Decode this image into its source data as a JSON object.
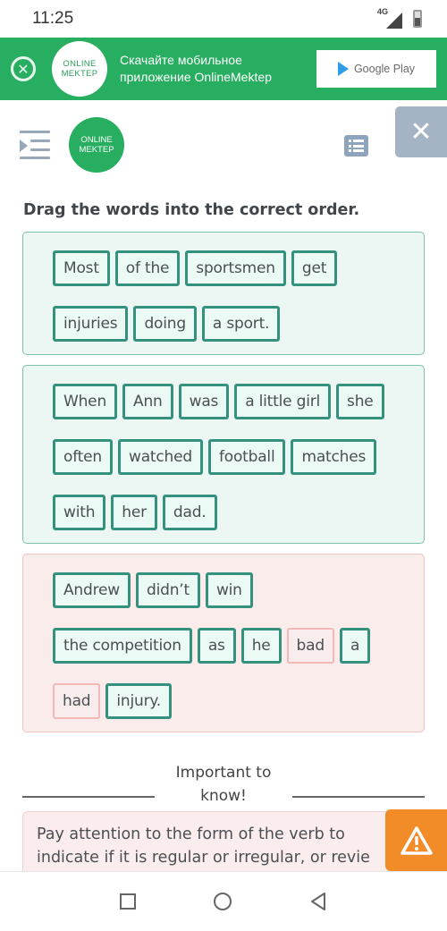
{
  "status_bar": {
    "time": "11:25",
    "network": "4G",
    "icons": [
      "signal-icon",
      "battery-charging-icon"
    ]
  },
  "promo_banner": {
    "close_icon": "close-circle-icon",
    "logo_line1": "ONLINE",
    "logo_line2": "MEKTEP",
    "text_line1": "Скачайте мобильное",
    "text_line2": "приложение OnlineMektep",
    "store_button_label": "Google Play",
    "color": "#27ae60"
  },
  "header": {
    "menu_icon": "indent-menu-icon",
    "logo_line1": "ONLINE",
    "logo_line2": "MEKTEP",
    "list_icon": "list-icon",
    "close_label": "✕"
  },
  "task": {
    "instruction": "Drag the words into the correct order.",
    "sentences": [
      {
        "status": "correct",
        "rows": [
          [
            {
              "text": "Most",
              "state": "correct"
            },
            {
              "text": "of the",
              "state": "correct"
            },
            {
              "text": "sportsmen",
              "state": "correct"
            },
            {
              "text": "get",
              "state": "correct"
            }
          ],
          [
            {
              "text": "injuries",
              "state": "correct"
            },
            {
              "text": "doing",
              "state": "correct"
            },
            {
              "text": "a sport.",
              "state": "correct"
            }
          ]
        ]
      },
      {
        "status": "correct",
        "rows": [
          [
            {
              "text": "When",
              "state": "correct"
            },
            {
              "text": "Ann",
              "state": "correct"
            },
            {
              "text": "was",
              "state": "correct"
            },
            {
              "text": "a little girl",
              "state": "correct"
            },
            {
              "text": "she",
              "state": "correct"
            }
          ],
          [
            {
              "text": "often",
              "state": "correct"
            },
            {
              "text": "watched",
              "state": "correct"
            },
            {
              "text": "football",
              "state": "correct"
            },
            {
              "text": "matches",
              "state": "correct"
            }
          ],
          [
            {
              "text": "with",
              "state": "correct"
            },
            {
              "text": "her",
              "state": "correct"
            },
            {
              "text": "dad.",
              "state": "correct"
            }
          ]
        ]
      },
      {
        "status": "wrong",
        "rows": [
          [
            {
              "text": "Andrew",
              "state": "correct"
            },
            {
              "text": "didn’t",
              "state": "correct"
            },
            {
              "text": "win",
              "state": "correct"
            }
          ],
          [
            {
              "text": "the competition",
              "state": "correct"
            },
            {
              "text": "as",
              "state": "correct"
            },
            {
              "text": "he",
              "state": "correct"
            },
            {
              "text": "bad",
              "state": "wrong"
            },
            {
              "text": "a",
              "state": "correct"
            }
          ],
          [
            {
              "text": "had",
              "state": "wrong"
            },
            {
              "text": "injury.",
              "state": "correct"
            }
          ]
        ]
      }
    ]
  },
  "important": {
    "line1": "Important to",
    "line2": "know!",
    "note": "Pay attention to the form of the verb to indicate if it is regular or irregular, or review",
    "note_line1": "Pay attention to the form of the verb to",
    "note_line2": "indicate if it is regular or irregular, or revie",
    "warning_icon": "warning-triangle-icon",
    "warning_color": "#f28c28"
  },
  "nav_bar": {
    "items": [
      "recent-apps-icon",
      "home-icon",
      "back-icon"
    ]
  }
}
